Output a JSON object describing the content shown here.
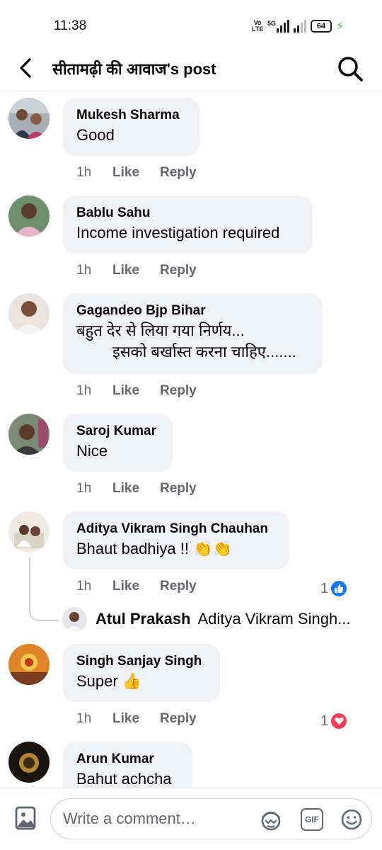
{
  "status": {
    "time": "11:38",
    "network": "Vo LTE",
    "signal": "5G",
    "battery": "64"
  },
  "header": {
    "title": "सीतामढ़ी की आवाज's post"
  },
  "actions": {
    "like_label": "Like",
    "reply_label": "Reply"
  },
  "comments": [
    {
      "name": "Mukesh Sharma",
      "text": "Good",
      "time": "1h"
    },
    {
      "name": "Bablu Sahu",
      "text": "Income investigation required",
      "time": "1h"
    },
    {
      "name": "Gagandeo Bjp Bihar",
      "text_line1": "बहुत देर से लिया गया निर्णय...",
      "text_line2": "इसको बर्खास्त करना चाहिए.......",
      "time": "1h"
    },
    {
      "name": "Saroj Kumar",
      "text": "Nice",
      "time": "1h"
    },
    {
      "name": "Aditya Vikram Singh Chauhan",
      "text": "Bhaut badhiya !! 👏👏",
      "time": "1h",
      "reaction_count": "1",
      "reaction": "like"
    },
    {
      "name": "Singh Sanjay Singh",
      "text": "Super 👍",
      "time": "1h",
      "reaction_count": "1",
      "reaction": "love"
    },
    {
      "name": "Arun Kumar",
      "text": "Bahut achcha"
    }
  ],
  "reply": {
    "name": "Atul Prakash",
    "text": "Aditya Vikram Singh..."
  },
  "composer": {
    "placeholder": "Write a comment…"
  },
  "colors": {
    "like_blue": "#1877f2",
    "love_red": "#f33e58",
    "bubble": "#f0f2f5",
    "meta_gray": "#65676b"
  }
}
